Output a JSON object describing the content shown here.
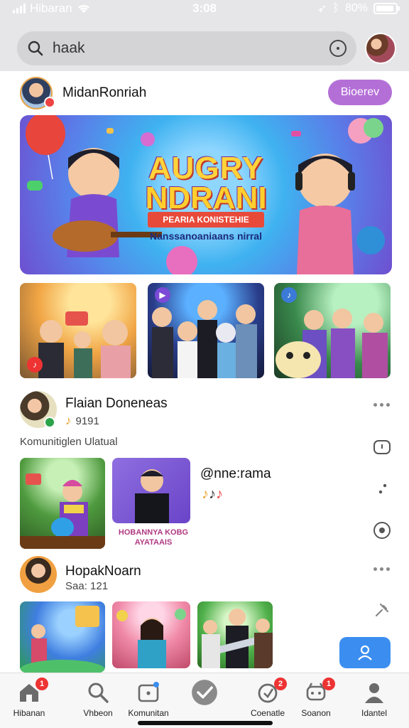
{
  "status": {
    "carrier": "Hibaran",
    "time": "3:08",
    "battery": "80%"
  },
  "search": {
    "value": "haak"
  },
  "profile": {
    "name": "MidanRonriah",
    "button_label": "Bioerev"
  },
  "banner": {
    "title_line1": "AUGRY",
    "title_line2": "NDRANI",
    "tag": "PEARIA KONISTEHIE",
    "subtitle": "Nanssanoaniaans nirral"
  },
  "feed": {
    "post1": {
      "title": "Flaian Doneneas",
      "meta": "9191"
    },
    "section_label": "Komunitiglen Ulatual",
    "media_card": {
      "handle": "@nne:rama",
      "caption": "HOBANNYA KOBGAYATAAIS"
    },
    "post2": {
      "title": "HopakNoarn",
      "meta": "Saa: 121"
    }
  },
  "colors": {
    "accent": "#3b8ef0",
    "button_purple": "#b46fd7",
    "badge_red": "#e33333"
  },
  "nav": [
    {
      "label": "Hibanan",
      "icon": "home-icon",
      "badge": "1"
    },
    {
      "label": "Vhbeon",
      "icon": "search-icon",
      "badge": ""
    },
    {
      "label": "Komunitan",
      "icon": "community-icon",
      "badge": ""
    },
    {
      "label": "",
      "icon": "check-icon",
      "badge": ""
    },
    {
      "label": "Coenatle",
      "icon": "create-icon",
      "badge": "2"
    },
    {
      "label": "Soanon",
      "icon": "notification-icon",
      "badge": "1"
    },
    {
      "label": "Idantel",
      "icon": "profile-icon",
      "badge": ""
    }
  ]
}
